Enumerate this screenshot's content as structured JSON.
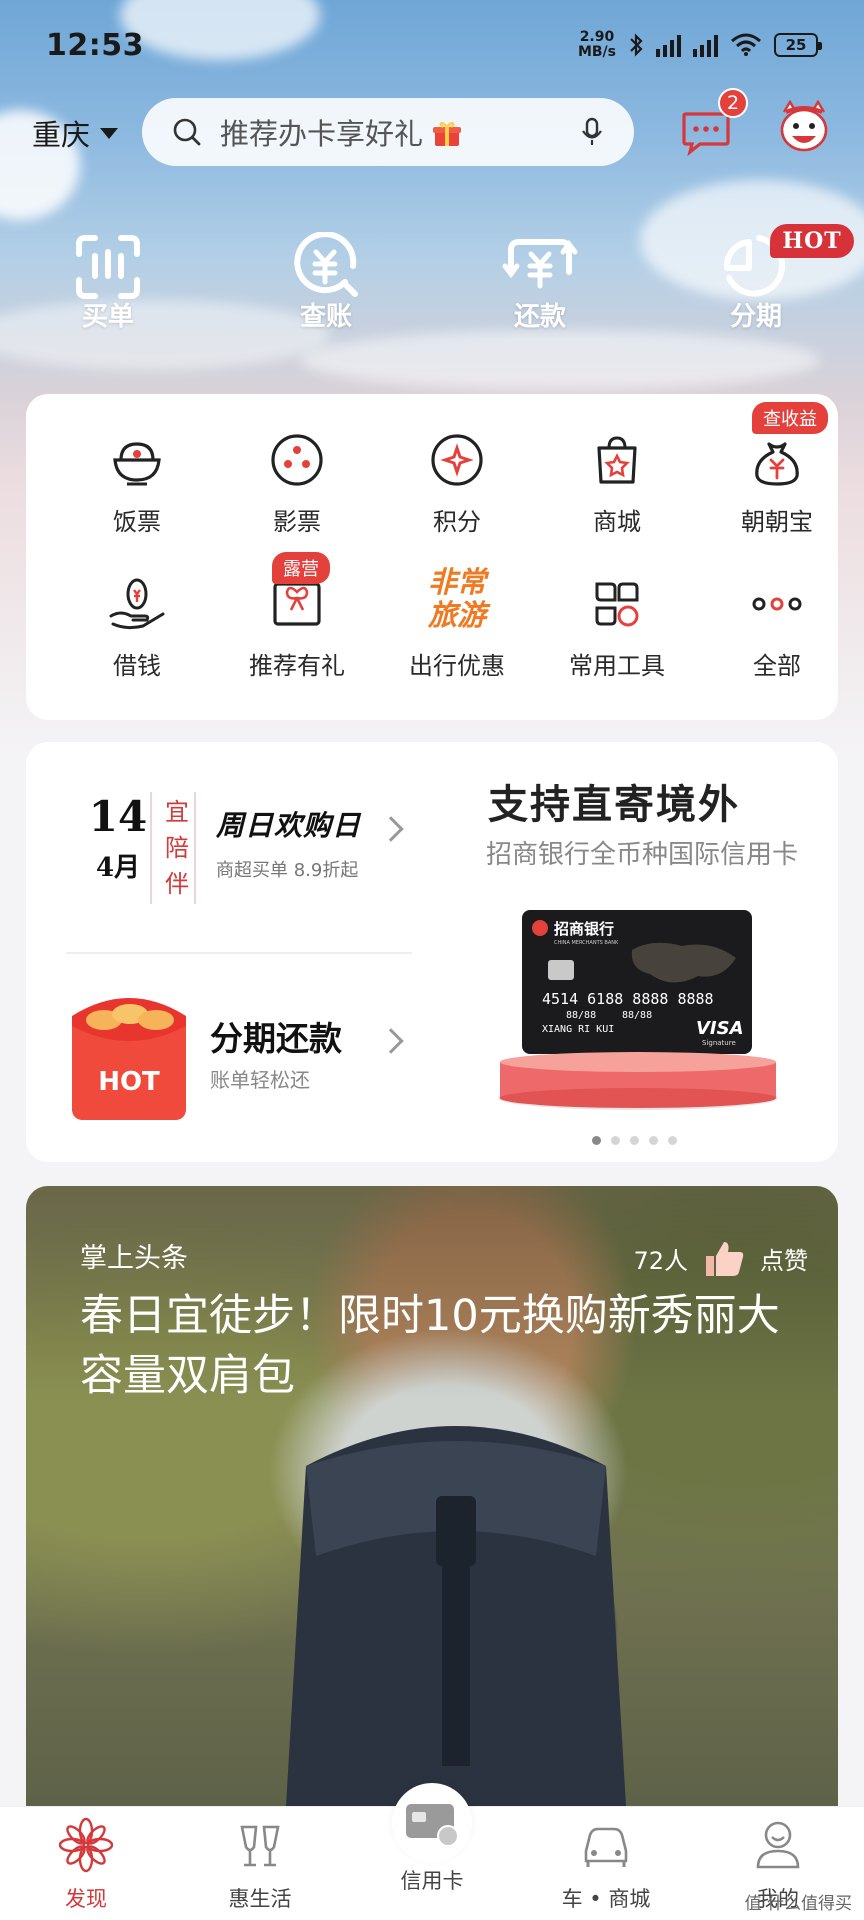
{
  "status_bar": {
    "time": "12:53",
    "net_speed_value": "2.90",
    "net_speed_unit": "MB/s",
    "battery": "25"
  },
  "header": {
    "city": "重庆",
    "search_placeholder": "推荐办卡享好礼",
    "message_count": "2"
  },
  "quick_actions": [
    {
      "label": "买单",
      "icon": "scan-pay-icon"
    },
    {
      "label": "查账",
      "icon": "check-bill-icon"
    },
    {
      "label": "还款",
      "icon": "repay-icon"
    },
    {
      "label": "分期",
      "icon": "installment-icon",
      "tag": "HOT"
    }
  ],
  "services": [
    {
      "label": "饭票",
      "icon": "rice-bowl-icon"
    },
    {
      "label": "影票",
      "icon": "film-reel-icon"
    },
    {
      "label": "积分",
      "icon": "points-icon"
    },
    {
      "label": "商城",
      "icon": "shopping-bag-icon"
    },
    {
      "label": "朝朝宝",
      "icon": "money-bag-icon",
      "tag": "查收益"
    },
    {
      "label": "借钱",
      "icon": "loan-hand-icon"
    },
    {
      "label": "推荐有礼",
      "icon": "gift-box-icon",
      "tag": "露营"
    },
    {
      "label": "出行优惠",
      "icon": "travel-logo-icon",
      "logo_text_1": "非常",
      "logo_text_2": "旅游"
    },
    {
      "label": "常用工具",
      "icon": "tools-icon"
    },
    {
      "label": "全部",
      "icon": "more-dots-icon"
    }
  ],
  "promo": {
    "date_day": "14",
    "date_month": "4月",
    "yi_chars": [
      "宜",
      "陪",
      "伴"
    ],
    "weekend_title": "周日欢购日",
    "weekend_sub": "商超买单 8.9折起",
    "installment_title": "分期还款",
    "installment_sub": "账单轻松还",
    "hot_label": "HOT",
    "ad_title": "支持直寄境外",
    "ad_sub": "招商银行全币种国际信用卡",
    "card": {
      "bank_name": "招商银行",
      "bank_name_en": "CHINA MERCHANTS BANK",
      "number": "4514 6188 8888 8888",
      "valid_thru": "88/88",
      "member_since": "88/88",
      "holder": "XIANG RI KUI",
      "network": "VISA",
      "network_sub": "Signature"
    },
    "carousel_total": 5,
    "carousel_active": 1
  },
  "news": {
    "source": "掌上头条",
    "likes_count": "72人",
    "like_label": "点赞",
    "title": "春日宜徒步！限时10元换购新秀丽大容量双肩包"
  },
  "bottom_nav": [
    {
      "label": "发现",
      "icon": "discover-flower-icon",
      "active": true
    },
    {
      "label": "惠生活",
      "icon": "cheers-glasses-icon",
      "active": false
    },
    {
      "label": "信用卡",
      "icon": "credit-card-icon",
      "active": false
    },
    {
      "label": "车 • 商城",
      "icon": "car-icon",
      "active": false
    },
    {
      "label": "我的",
      "icon": "profile-icon",
      "active": false
    }
  ],
  "watermark": "值 什么值得买",
  "colors": {
    "accent_red": "#d5373a",
    "badge_red": "#e5413c",
    "sky_blue": "#8db9e0"
  }
}
